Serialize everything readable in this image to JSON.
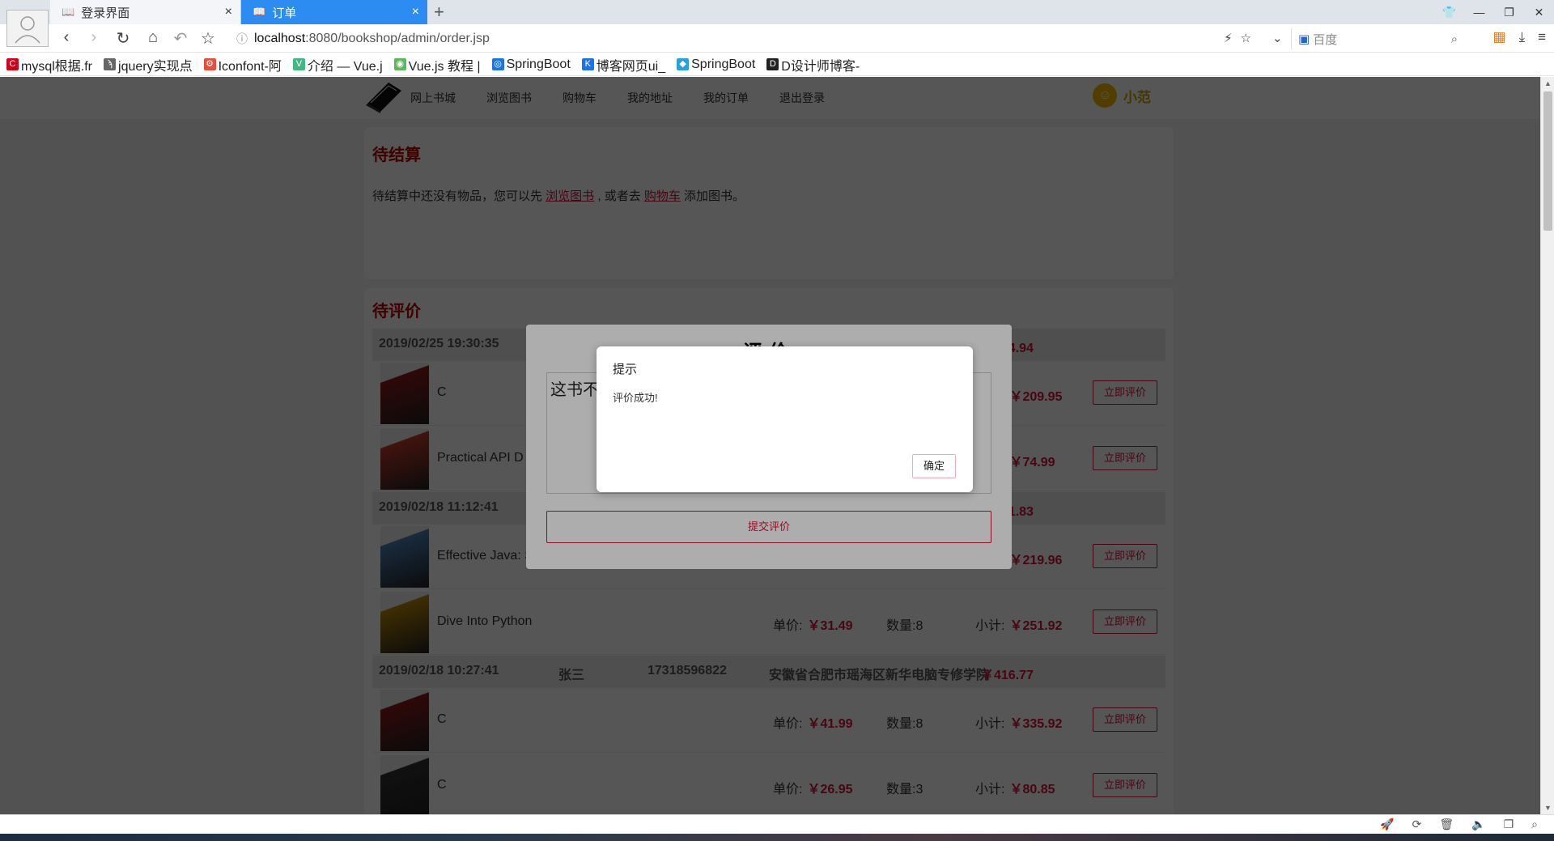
{
  "browser": {
    "tabs": [
      {
        "label": "登录界面",
        "active": false
      },
      {
        "label": "订单",
        "active": true
      }
    ],
    "url_host": "localhost",
    "url_rest": ":8080/bookshop/admin/order.jsp",
    "search_placeholder": "百度",
    "bookmarks": [
      {
        "label": "mysql根据.fr",
        "color": "#d0021b",
        "icon": "C"
      },
      {
        "label": "jquery实现点",
        "color": "#666666",
        "icon": "ϡ"
      },
      {
        "label": "Iconfont-阿",
        "color": "#e74c3c",
        "icon": "⚙"
      },
      {
        "label": "介绍 — Vue.j",
        "color": "#41b883",
        "icon": "V"
      },
      {
        "label": "Vue.js 教程 |",
        "color": "#5cb85c",
        "icon": "◉"
      },
      {
        "label": "SpringBoot",
        "color": "#1a73e8",
        "icon": "◎"
      },
      {
        "label": "博客网页ui_",
        "color": "#1a73e8",
        "icon": "K"
      },
      {
        "label": "SpringBoot",
        "color": "#29a0e0",
        "icon": "◆"
      },
      {
        "label": "D设计师博客-",
        "color": "#222222",
        "icon": "D"
      }
    ]
  },
  "site": {
    "brand": "网上书城",
    "nav": [
      "浏览图书",
      "购物车",
      "我的地址",
      "我的订单",
      "退出登录"
    ],
    "user_name": "小范"
  },
  "pending_checkout": {
    "title": "待结算",
    "msg_prefix": "待结算中还没有物品，您可以先 ",
    "link_browse": "浏览图书",
    "msg_mid": " , 或者去 ",
    "link_cart": "购物车",
    "msg_suffix": " 添加图书。"
  },
  "pending_review": {
    "title": "待评价",
    "price_label": "单价:",
    "qty_label": "数量:",
    "subtotal_label": "小计:",
    "rate_button": "立即评价",
    "orders": [
      {
        "time": "2019/02/25 19:30:35",
        "name": "",
        "phone": "",
        "address": "",
        "total": "￥284.94",
        "items": [
          {
            "title": "C",
            "price": "",
            "qty": "",
            "subtotal": "￥209.95",
            "cover": "#8a1a1a"
          },
          {
            "title": "Practical API D",
            "price": "",
            "qty": "",
            "subtotal": "￥74.99",
            "cover": "#c0392b"
          }
        ]
      },
      {
        "time": "2019/02/18 11:12:41",
        "name": "",
        "phone": "",
        "address": "",
        "total": "￥681.83",
        "items": [
          {
            "title": "Effective Java: Second Edition",
            "price": "",
            "qty": "",
            "subtotal": "￥219.96",
            "cover": "#4a7fb5"
          },
          {
            "title": "Dive Into Python",
            "price": "￥31.49",
            "qty": "8",
            "subtotal": "￥251.92",
            "cover": "#b8860b"
          }
        ]
      },
      {
        "time": "2019/02/18 10:27:41",
        "name": "张三",
        "phone": "17318596822",
        "address": "安徽省合肥市瑶海区新华电脑专修学院",
        "total": "￥416.77",
        "items": [
          {
            "title": "C",
            "price": "￥41.99",
            "qty": "8",
            "subtotal": "￥335.92",
            "cover": "#8a1a1a"
          },
          {
            "title": "C",
            "price": "￥26.95",
            "qty": "3",
            "subtotal": "￥80.85",
            "cover": "#333333"
          }
        ]
      }
    ]
  },
  "eval_dialog": {
    "title": "评价",
    "text": "这书不",
    "submit": "提交评价"
  },
  "alert": {
    "title": "提示",
    "message": "评价成功!",
    "ok": "确定"
  },
  "colors": {
    "accent": "#d2143a",
    "tab_active": "#2c8cf2"
  }
}
